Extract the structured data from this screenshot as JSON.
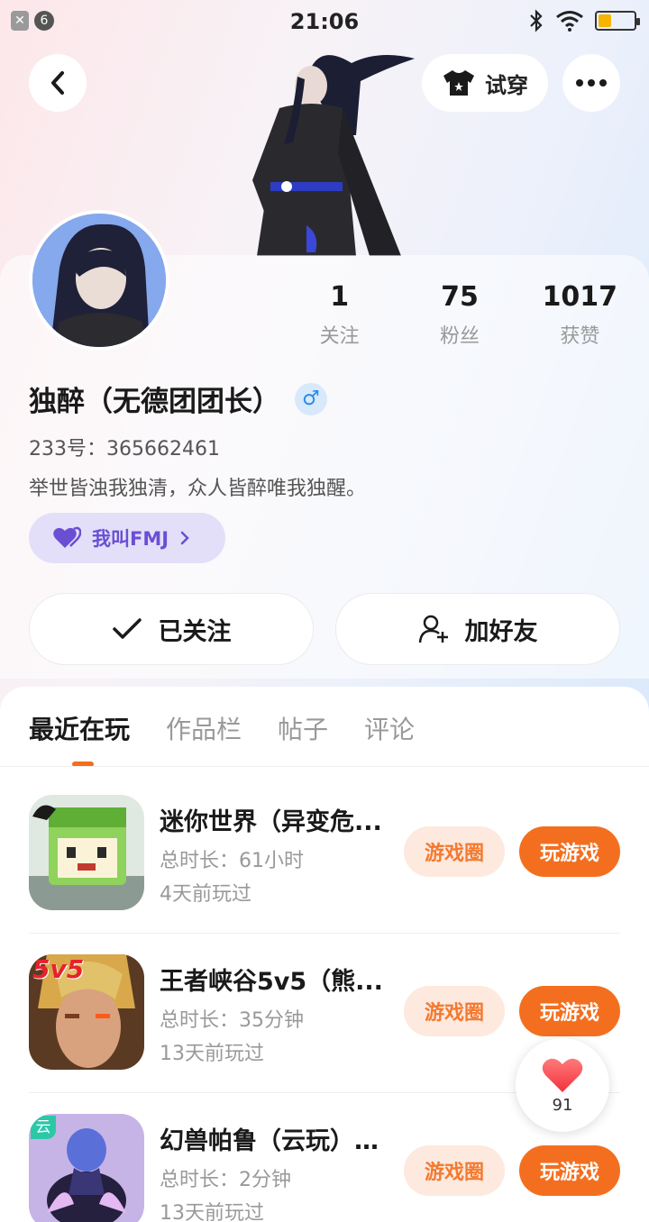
{
  "status_bar": {
    "time": "21:06",
    "notif_badge": "6"
  },
  "header": {
    "try_on_label": "试穿"
  },
  "profile": {
    "following_count": "1",
    "following_label": "关注",
    "fans_count": "75",
    "fans_label": "粉丝",
    "likes_count": "1017",
    "likes_label": "获赞",
    "username": "独醉（无德团团长）",
    "gender_symbol": "♂",
    "uid": "233号：365662461",
    "bio": "举世皆浊我独清，众人皆醉唯我独醒。",
    "tag_label": "我叫FMJ",
    "followed_label": "已关注",
    "add_friend_label": "加好友"
  },
  "tabs": [
    "最近在玩",
    "作品栏",
    "帖子",
    "评论"
  ],
  "games": [
    {
      "name": "迷你世界（异变危...",
      "duration": "总时长：61小时",
      "last_played": "4天前玩过"
    },
    {
      "name": "王者峡谷5v5（熊...",
      "duration": "总时长：35分钟",
      "last_played": "13天前玩过"
    },
    {
      "name": "幻兽帕鲁（云玩）-...",
      "duration": "总时长：2分钟",
      "last_played": "13天前玩过"
    }
  ],
  "game_buttons": {
    "circle": "游戏圈",
    "play": "玩游戏"
  },
  "icon_text": {
    "game2_badge": "5v5",
    "game3_badge": "云"
  },
  "floating_like": {
    "count": "91"
  },
  "colors": {
    "accent": "#f36f1f",
    "tag_purple": "#6a4fd3",
    "gender_blue": "#2b8ae8"
  }
}
